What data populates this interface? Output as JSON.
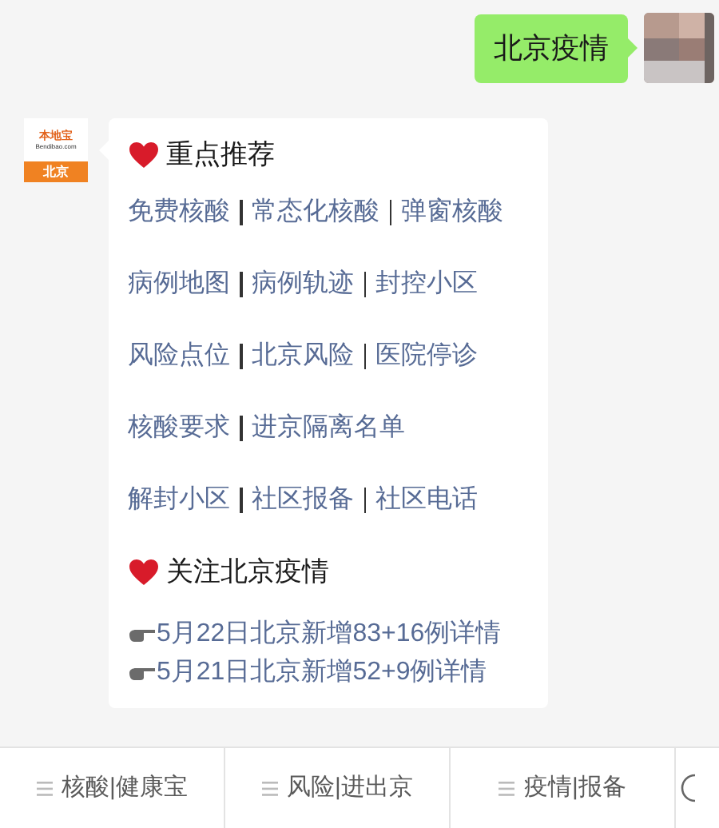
{
  "outgoing_message": {
    "text": "北京疫情"
  },
  "sender_logo": {
    "brand": "本地宝",
    "site": "Bendibao.com",
    "city": "北京"
  },
  "reply": {
    "sections": [
      {
        "heading": "重点推荐",
        "kind": "links",
        "rows": [
          [
            "免费核酸",
            "常态化核酸",
            "弹窗核酸"
          ],
          [
            "病例地图",
            "病例轨迹",
            "封控小区"
          ],
          [
            "风险点位",
            "北京风险",
            "医院停诊"
          ],
          [
            "核酸要求",
            "进京隔离名单"
          ],
          [
            "解封小区",
            "社区报备",
            "社区电话"
          ]
        ]
      },
      {
        "heading": "关注北京疫情",
        "kind": "news",
        "items": [
          "5月22日北京新增83+16例详情",
          "5月21日北京新增52+9例详情"
        ]
      }
    ]
  },
  "menu_bar": {
    "items": [
      {
        "label": "核酸|健康宝"
      },
      {
        "label": "风险|进出京"
      },
      {
        "label": "疫情|报备"
      }
    ]
  }
}
